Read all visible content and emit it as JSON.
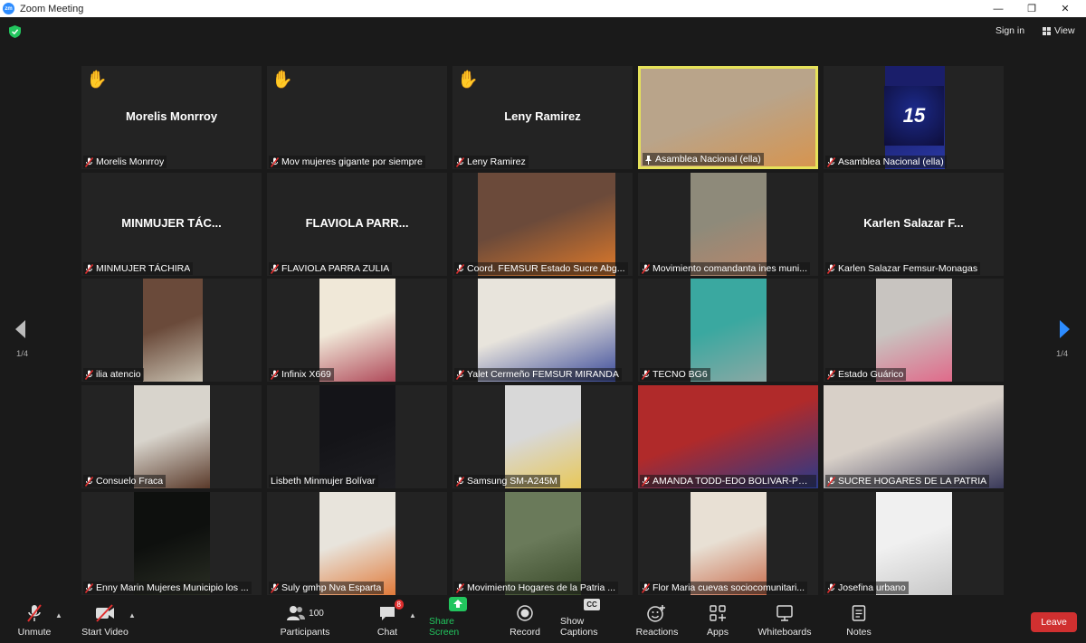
{
  "window": {
    "title": "Zoom Meeting",
    "logo": "zm"
  },
  "topbar": {
    "signin": "Sign in",
    "view": "View"
  },
  "pager": {
    "left": "1/4",
    "right": "1/4"
  },
  "tiles": [
    {
      "name": "Morelis Monrroy",
      "big": "Morelis Monrroy",
      "hand": "✋"
    },
    {
      "name": "Mov mujeres gigante por siempre",
      "hand": "✋"
    },
    {
      "name": "Leny Ramirez",
      "big": "Leny Ramirez",
      "hand": "✋"
    },
    {
      "name": "Asamblea Nacional (ella)"
    },
    {
      "name": "Asamblea Nacional (ella)",
      "logo": "15"
    },
    {
      "name": "MINMUJER TÁCHIRA",
      "big": "MINMUJER  TÁC..."
    },
    {
      "name": "FLAVIOLA PARRA ZULIA",
      "big": "FLAVIOLA  PARR..."
    },
    {
      "name": "Coord. FEMSUR Estado Sucre Abg..."
    },
    {
      "name": "Movimiento comandanta ines muni..."
    },
    {
      "name": "Karlen Salazar Femsur-Monagas",
      "big": "Karlen Salazar  F..."
    },
    {
      "name": "ilia atencio"
    },
    {
      "name": "Infinix X669"
    },
    {
      "name": "Yalet Cermeño FEMSUR MIRANDA"
    },
    {
      "name": "TECNO BG6"
    },
    {
      "name": "Estado Guárico"
    },
    {
      "name": "Consuelo Fraca"
    },
    {
      "name": "Lisbeth Minmujer Bolívar"
    },
    {
      "name": "Samsung SM-A245M"
    },
    {
      "name": "AMANDA TODD-EDO BOLIVAR-PSUV"
    },
    {
      "name": "SUCRE HOGARES DE LA PATRIA"
    },
    {
      "name": "Enny Marin Mujeres Municipio los ..."
    },
    {
      "name": "Suly gmhp Nva Esparta"
    },
    {
      "name": "Movimiento  Hogares de la Patria ..."
    },
    {
      "name": "Flor Maria cuevas sociocomunitari..."
    },
    {
      "name": "Josefina urbano"
    }
  ],
  "toolbar": {
    "unmute": "Unmute",
    "start_video": "Start Video",
    "participants": "Participants",
    "participants_count": "100",
    "chat": "Chat",
    "chat_badge": "8",
    "share_screen": "Share Screen",
    "record": "Record",
    "show_captions": "Show Captions",
    "captions_icon": "CC",
    "reactions": "Reactions",
    "apps": "Apps",
    "whiteboards": "Whiteboards",
    "notes": "Notes",
    "leave": "Leave"
  },
  "colors": {
    "active_speaker": "#e6e25a",
    "share": "#22c55e",
    "leave": "#d03030",
    "mic_off": "#e02e2e"
  }
}
